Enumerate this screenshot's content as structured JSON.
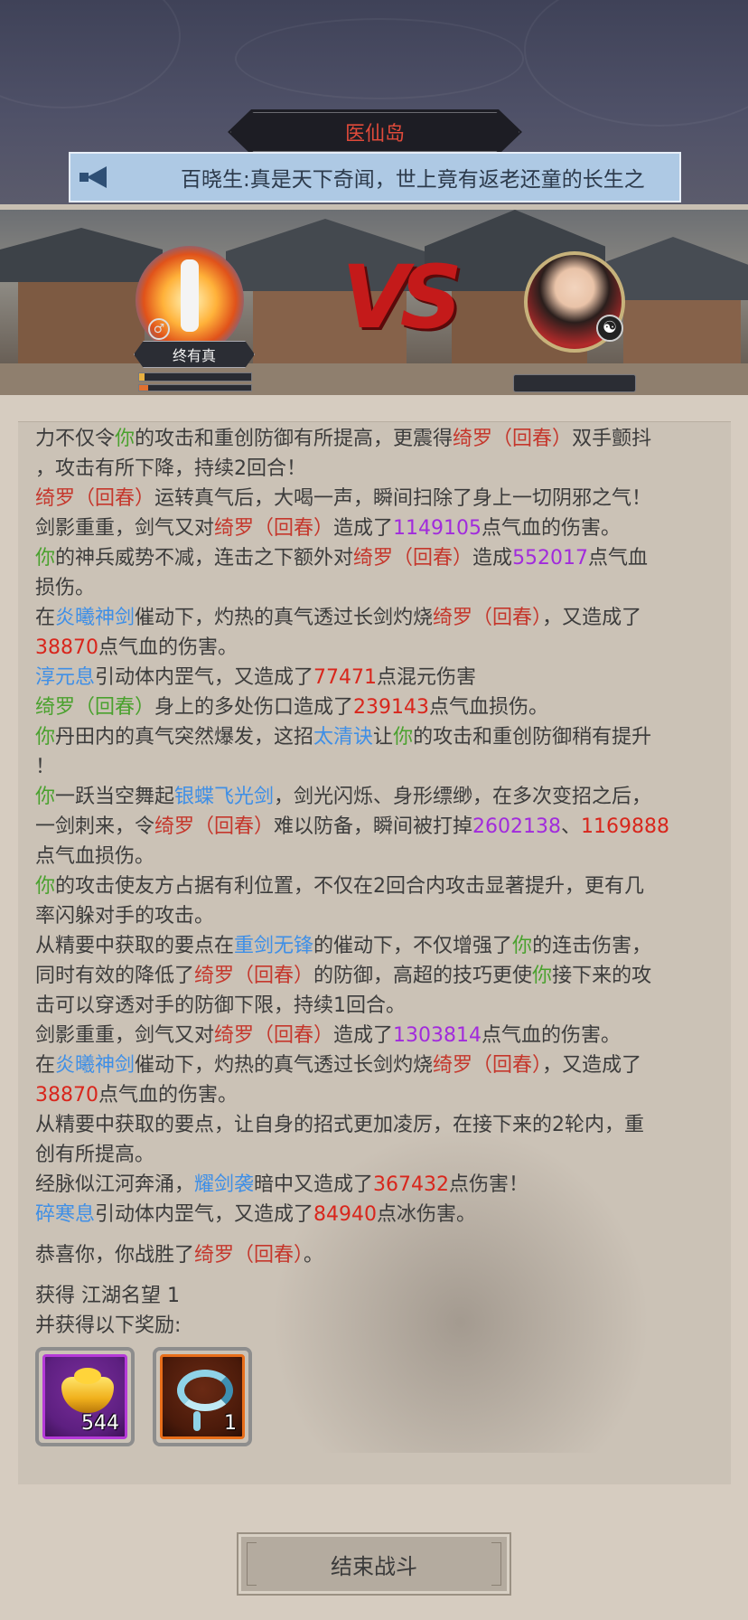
{
  "header": {
    "location": "医仙岛",
    "announcement": "百晓生:真是天下奇闻，世上竟有返老还童的长生之"
  },
  "battle": {
    "player_name": "终有真",
    "player_hp_fraction": 0.05,
    "player_mp_fraction": 0.08,
    "vs_text": "VS",
    "enemy_name": ""
  },
  "log": [
    [
      [
        "力不仅令",
        ""
      ],
      [
        "你",
        "green"
      ],
      [
        "的攻击和重创防御有所提高，更震得",
        ""
      ],
      [
        "绮罗（回春）",
        "red"
      ],
      [
        "双手颤抖",
        ""
      ]
    ],
    [
      [
        "，攻击有所下降，持续2回合！",
        ""
      ]
    ],
    [
      [
        "绮罗（回春）",
        "red"
      ],
      [
        "运转真气后，大喝一声，瞬间扫除了身上一切阴邪之气！",
        ""
      ]
    ],
    [
      [
        "剑影重重，剑气又对",
        ""
      ],
      [
        "绮罗（回春）",
        "red"
      ],
      [
        "造成了",
        ""
      ],
      [
        "1149105",
        "purple"
      ],
      [
        "点气血的伤害。",
        ""
      ]
    ],
    [
      [
        "你",
        "green"
      ],
      [
        "的神兵威势不减，连击之下额外对",
        ""
      ],
      [
        "绮罗（回春）",
        "red"
      ],
      [
        "造成",
        ""
      ],
      [
        "552017",
        "purple"
      ],
      [
        "点气血",
        ""
      ]
    ],
    [
      [
        "损伤。",
        ""
      ]
    ],
    [
      [
        "在",
        ""
      ],
      [
        "炎曦神剑",
        "blue"
      ],
      [
        "催动下，灼热的真气透过长剑灼烧",
        ""
      ],
      [
        "绮罗（回春）",
        "red"
      ],
      [
        "，又造成了",
        ""
      ]
    ],
    [
      [
        "38870",
        "bright-red"
      ],
      [
        "点气血的伤害。",
        ""
      ]
    ],
    [
      [
        "淳元息",
        "blue"
      ],
      [
        "引动体内罡气，又造成了",
        ""
      ],
      [
        "77471",
        "bright-red"
      ],
      [
        "点混元伤害",
        ""
      ]
    ],
    [
      [
        "绮罗（回春）",
        "green"
      ],
      [
        "身上的多处伤口造成了",
        ""
      ],
      [
        "239143",
        "bright-red"
      ],
      [
        "点气血损伤。",
        ""
      ]
    ],
    [
      [
        "你",
        "green"
      ],
      [
        "丹田内的真气突然爆发，这招",
        ""
      ],
      [
        "太清诀",
        "blue"
      ],
      [
        "让",
        ""
      ],
      [
        "你",
        "green"
      ],
      [
        "的攻击和重创防御稍有提升",
        ""
      ]
    ],
    [
      [
        "！",
        ""
      ]
    ],
    [
      [
        "你",
        "green"
      ],
      [
        "一跃当空舞起",
        ""
      ],
      [
        "银蝶飞光剑",
        "blue"
      ],
      [
        "，剑光闪烁、身形缥缈，在多次变招之后，",
        ""
      ]
    ],
    [
      [
        "一剑刺来，令",
        ""
      ],
      [
        "绮罗（回春）",
        "red"
      ],
      [
        "难以防备，瞬间被打掉",
        ""
      ],
      [
        "2602138",
        "purple"
      ],
      [
        "、",
        ""
      ],
      [
        "1169888",
        "bright-red"
      ]
    ],
    [
      [
        "点气血损伤。",
        ""
      ]
    ],
    [
      [
        "你",
        "green"
      ],
      [
        "的攻击使友方占据有利位置，不仅在2回合内攻击显著提升，更有几",
        ""
      ]
    ],
    [
      [
        "率闪躲对手的攻击。",
        ""
      ]
    ],
    [
      [
        "从精要中获取的要点在",
        ""
      ],
      [
        "重剑无锋",
        "blue"
      ],
      [
        "的催动下，不仅增强了",
        ""
      ],
      [
        "你",
        "green"
      ],
      [
        "的连击伤害，",
        ""
      ]
    ],
    [
      [
        "同时有效的降低了",
        ""
      ],
      [
        "绮罗（回春）",
        "red"
      ],
      [
        "的防御，高超的技巧更使",
        ""
      ],
      [
        "你",
        "green"
      ],
      [
        "接下来的攻",
        ""
      ]
    ],
    [
      [
        "击可以穿透对手的防御下限，持续1回合。",
        ""
      ]
    ],
    [
      [
        "剑影重重，剑气又对",
        ""
      ],
      [
        "绮罗（回春）",
        "red"
      ],
      [
        "造成了",
        ""
      ],
      [
        "1303814",
        "purple"
      ],
      [
        "点气血的伤害。",
        ""
      ]
    ],
    [
      [
        "在",
        ""
      ],
      [
        "炎曦神剑",
        "blue"
      ],
      [
        "催动下，灼热的真气透过长剑灼烧",
        ""
      ],
      [
        "绮罗（回春）",
        "red"
      ],
      [
        "，又造成了",
        ""
      ]
    ],
    [
      [
        "38870",
        "bright-red"
      ],
      [
        "点气血的伤害。",
        ""
      ]
    ],
    [
      [
        "从精要中获取的要点，让自身的招式更加凌厉，在接下来的2轮内，重",
        ""
      ]
    ],
    [
      [
        "创有所提高。",
        ""
      ]
    ],
    [
      [
        "经脉似江河奔涌，",
        ""
      ],
      [
        "耀剑袭",
        "blue"
      ],
      [
        "暗中又造成了",
        ""
      ],
      [
        "367432",
        "bright-red"
      ],
      [
        "点伤害！",
        ""
      ]
    ],
    [
      [
        "碎寒息",
        "blue"
      ],
      [
        "引动体内罡气，又造成了",
        ""
      ],
      [
        "84940",
        "bright-red"
      ],
      [
        "点冰伤害。",
        ""
      ]
    ]
  ],
  "result": {
    "victory_prefix": "恭喜你，你战胜了",
    "victory_enemy": "绮罗（回春）",
    "victory_suffix": "。",
    "fame": "获得 江湖名望 1",
    "reward_heading": "并获得以下奖励:"
  },
  "rewards": [
    {
      "icon": "gold-ingot-icon",
      "count": "544",
      "frame_color": "#b53ad8"
    },
    {
      "icon": "cloud-swirl-icon",
      "count": "1",
      "frame_color": "#e86e1a"
    }
  ],
  "actions": {
    "end_battle_label": "结束战斗"
  },
  "colors": {
    "green": "#4aa12e",
    "red": "#c5372c",
    "blue": "#3f8fe6",
    "purple": "#a12bdc",
    "bright-red": "#d8261c"
  }
}
